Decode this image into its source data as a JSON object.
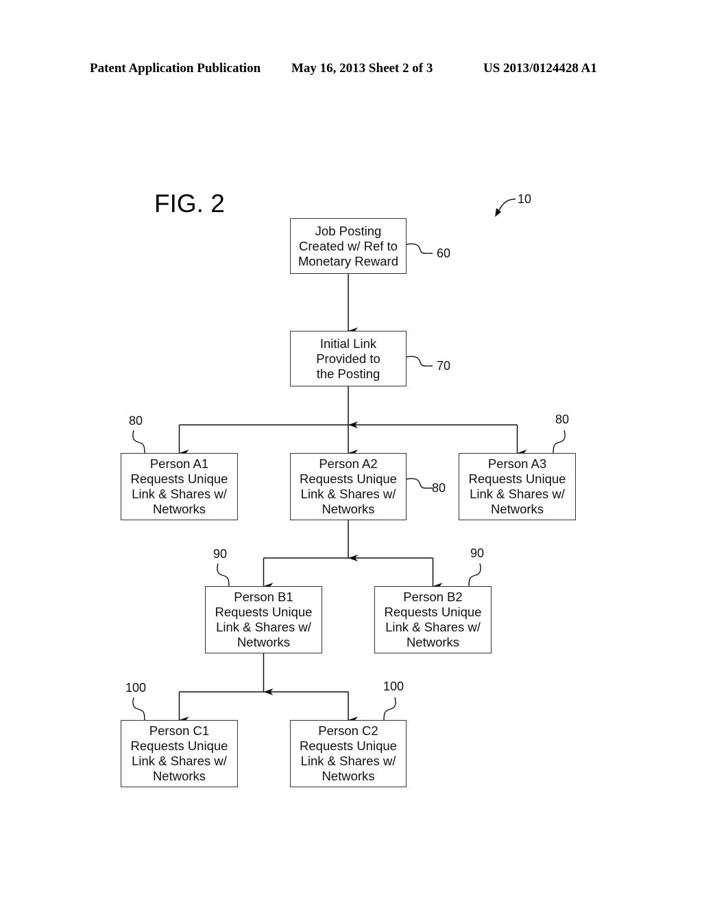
{
  "header": {
    "left": "Patent Application Publication",
    "middle": "May 16, 2013   Sheet 2 of 3",
    "right": "US 2013/0124428 A1"
  },
  "figure": {
    "label": "FIG. 2",
    "system_ref": "10"
  },
  "nodes": {
    "n60": {
      "ref": "60",
      "lines": [
        "Job Posting",
        "Created w/ Ref to",
        "Monetary Reward"
      ]
    },
    "n70": {
      "ref": "70",
      "lines": [
        "Initial Link",
        "Provided to",
        "the Posting"
      ]
    },
    "a1": {
      "ref": "80",
      "lines": [
        "Person A1",
        "Requests Unique",
        "Link & Shares w/",
        "Networks"
      ]
    },
    "a2": {
      "ref": "80",
      "lines": [
        "Person A2",
        "Requests Unique",
        "Link & Shares w/",
        "Networks"
      ]
    },
    "a3": {
      "ref": "80",
      "lines": [
        "Person A3",
        "Requests Unique",
        "Link & Shares w/",
        "Networks"
      ]
    },
    "b1": {
      "ref": "90",
      "lines": [
        "Person B1",
        "Requests Unique",
        "Link & Shares w/",
        "Networks"
      ]
    },
    "b2": {
      "ref": "90",
      "lines": [
        "Person B2",
        "Requests Unique",
        "Link & Shares w/",
        "Networks"
      ]
    },
    "c1": {
      "ref": "100",
      "lines": [
        "Person C1",
        "Requests Unique",
        "Link & Shares w/",
        "Networks"
      ]
    },
    "c2": {
      "ref": "100",
      "lines": [
        "Person C2",
        "Requests Unique",
        "Link & Shares w/",
        "Networks"
      ]
    }
  },
  "edges": [
    [
      "n60",
      "n70"
    ],
    [
      "n70",
      "a1"
    ],
    [
      "n70",
      "a2"
    ],
    [
      "n70",
      "a3"
    ],
    [
      "a2",
      "b1"
    ],
    [
      "a2",
      "b2"
    ],
    [
      "b1",
      "c1"
    ],
    [
      "b1",
      "c2"
    ]
  ]
}
